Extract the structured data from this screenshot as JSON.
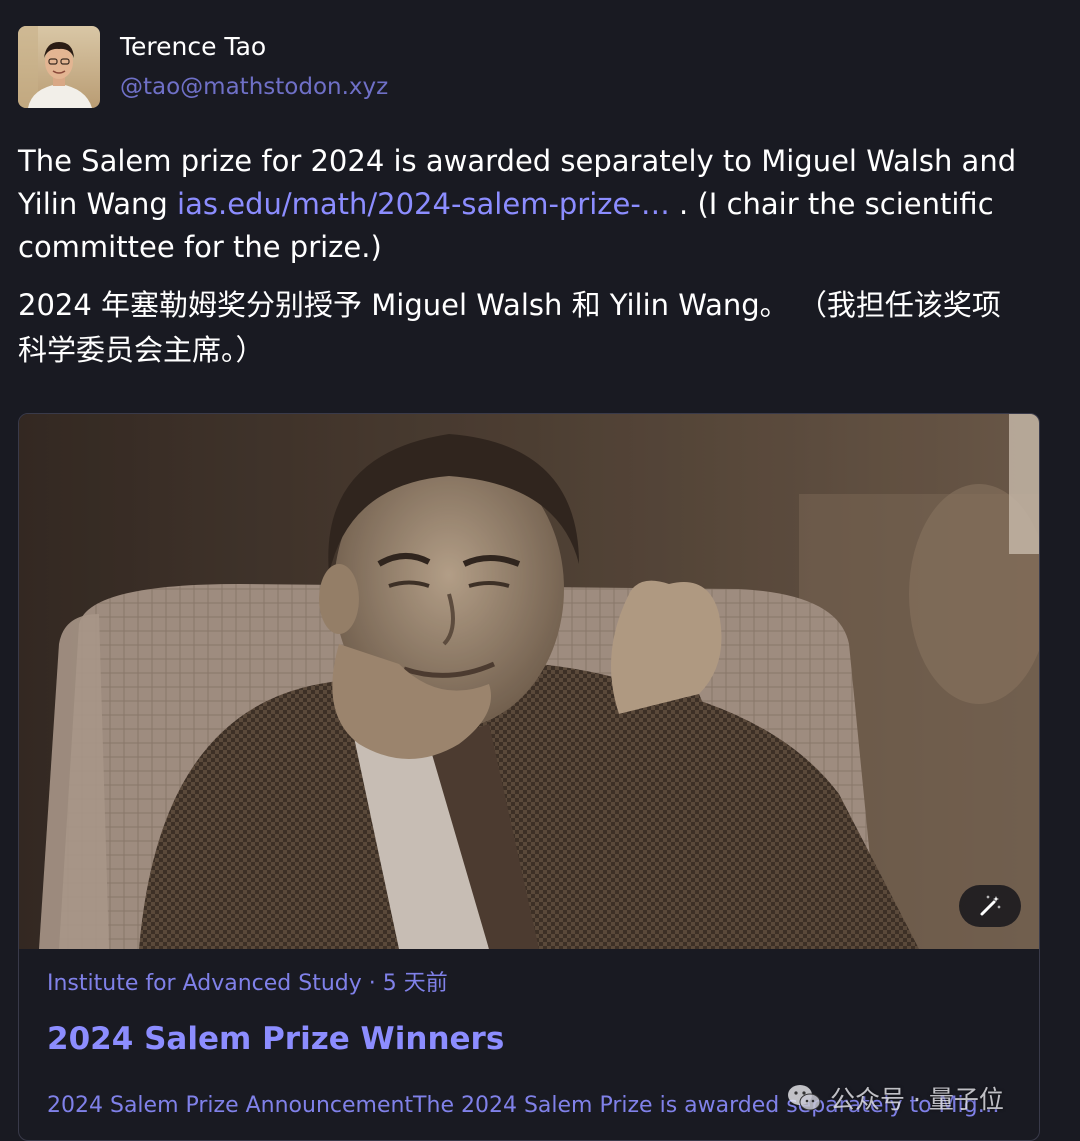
{
  "author": {
    "display_name": "Terence Tao",
    "handle": "@tao@mathstodon.xyz"
  },
  "status": {
    "line1_before_link": "The Salem prize for 2024 is awarded separately to Miguel Walsh and Yilin Wang ",
    "link_text": "ias.edu/math/2024-salem-prize-…",
    "line1_after_link": " .  (I chair the scientific committee for the prize.)",
    "line2": "2024 年塞勒姆奖分别授予 Miguel Walsh 和 Yilin Wang。  （我担任该奖项科学委员会主席。）"
  },
  "card": {
    "meta": "Institute for Advanced Study · 5 天前",
    "title": "2024 Salem Prize Winners",
    "description": "2024 Salem Prize AnnouncementThe 2024 Salem Prize is awarded separately to Miguel..."
  },
  "watermark": {
    "text": "公众号 · 量子位"
  },
  "colors": {
    "background": "#191a22",
    "link": "#8c8dff",
    "card_border": "#393a4a"
  },
  "icons": {
    "alt_badge": "magic-wand-icon",
    "watermark": "wechat-icon"
  }
}
